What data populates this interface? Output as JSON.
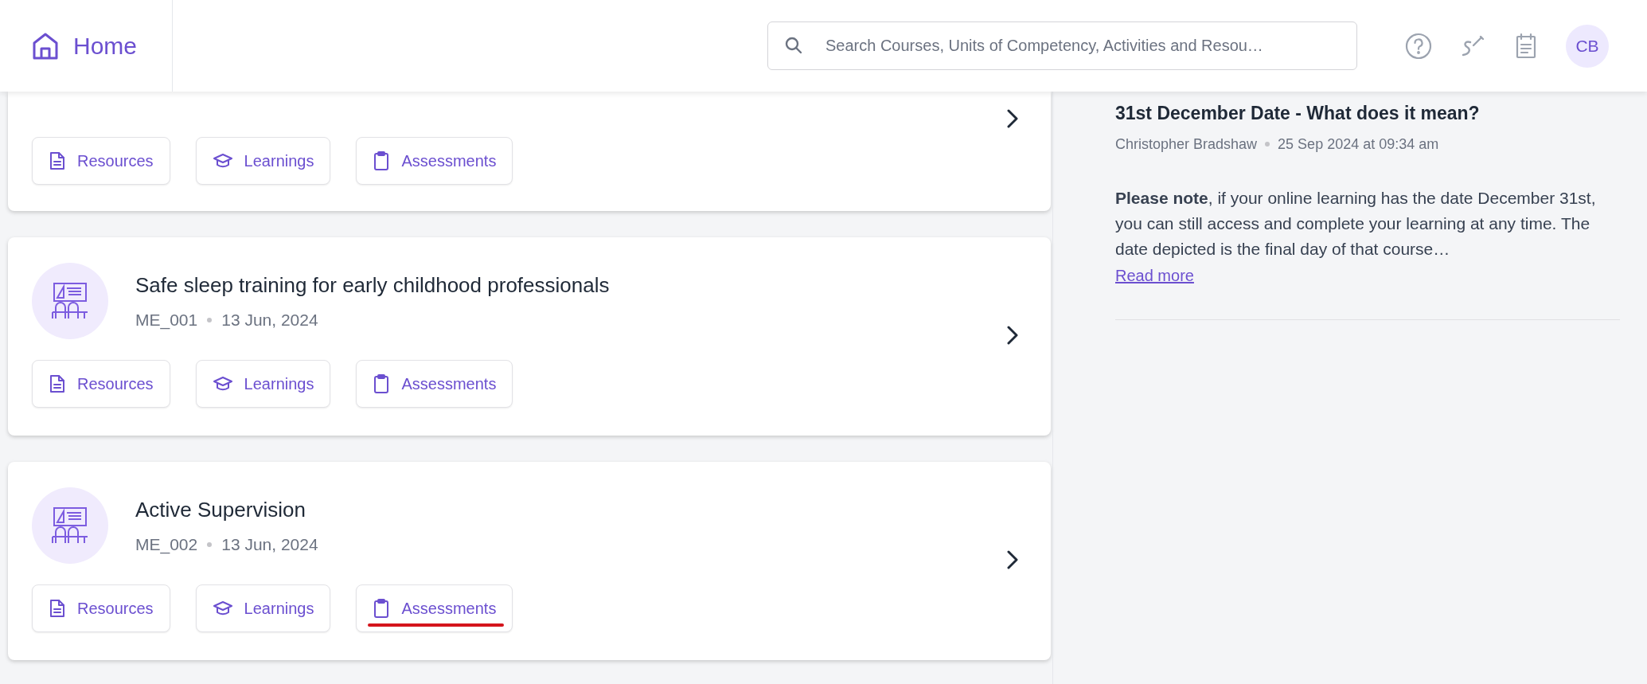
{
  "header": {
    "home_label": "Home",
    "search": {
      "placeholder": "Search Courses, Units of Competency, Activities and Resou…"
    },
    "avatar": "CB"
  },
  "courses": [
    {
      "buttons": [
        {
          "kind": "resources",
          "label": "Resources",
          "underlined": false
        },
        {
          "kind": "learnings",
          "label": "Learnings",
          "underlined": false
        },
        {
          "kind": "assessments",
          "label": "Assessments",
          "underlined": false
        }
      ]
    },
    {
      "title": "Safe sleep training for early childhood professionals",
      "code": "ME_001",
      "date": "13 Jun, 2024",
      "buttons": [
        {
          "kind": "resources",
          "label": "Resources",
          "underlined": false
        },
        {
          "kind": "learnings",
          "label": "Learnings",
          "underlined": false
        },
        {
          "kind": "assessments",
          "label": "Assessments",
          "underlined": false
        }
      ]
    },
    {
      "title": "Active Supervision",
      "code": "ME_002",
      "date": "13 Jun, 2024",
      "buttons": [
        {
          "kind": "resources",
          "label": "Resources",
          "underlined": false
        },
        {
          "kind": "learnings",
          "label": "Learnings",
          "underlined": false
        },
        {
          "kind": "assessments",
          "label": "Assessments",
          "underlined": true
        }
      ]
    }
  ],
  "notice": {
    "title": "31st December Date - What does it mean?",
    "author": "Christopher Bradshaw",
    "posted": "25 Sep 2024 at 09:34 am",
    "body": "**Please note**, if your online learning has the date December 31st, you can still access and complete your learning at any time. The date depicted is the final day of that course…",
    "link": "Read more"
  }
}
